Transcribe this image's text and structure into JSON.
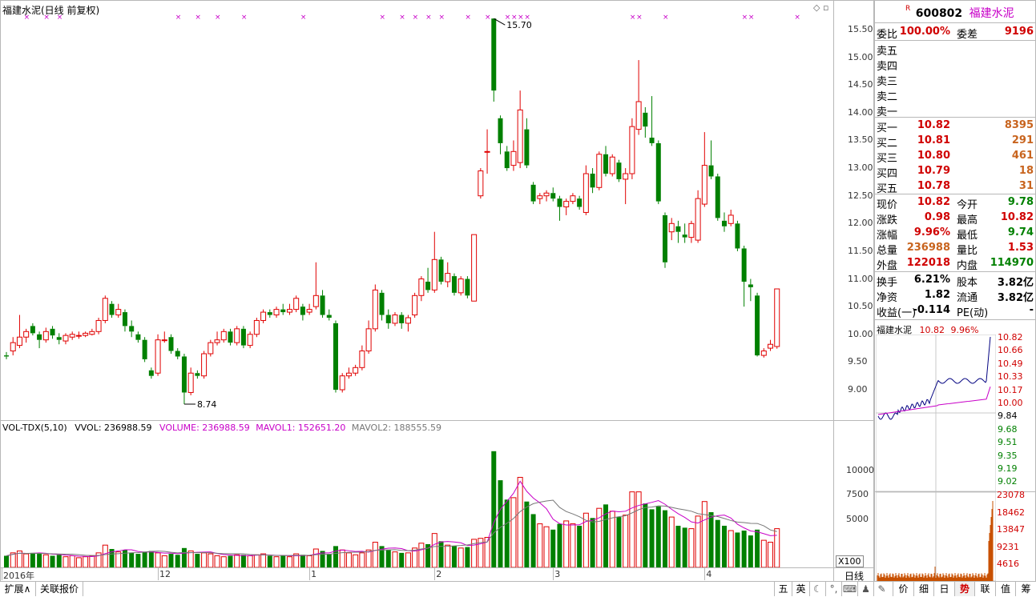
{
  "main": {
    "title": "福建水泥(日线 前复权)",
    "high_label": "15.70",
    "low_label": "8.74",
    "price_axis": [
      "15.50",
      "15.00",
      "14.50",
      "14.00",
      "13.50",
      "13.00",
      "12.50",
      "12.00",
      "11.50",
      "11.00",
      "10.50",
      "10.00",
      "9.50",
      "9.00"
    ],
    "date_axis": [
      "2016年",
      "12",
      "1",
      "2",
      "3",
      "4"
    ]
  },
  "volume": {
    "indicator": "VOL-TDX(5,10)",
    "vvol_label": "VVOL: 236988.59",
    "volume_label": "VOLUME: 236988.59",
    "mavol1_label": "MAVOL1: 152651.20",
    "mavol2_label": "MAVOL2: 188555.59",
    "axis": [
      "10000",
      "7500",
      "5000"
    ],
    "unit": "X100"
  },
  "quote": {
    "badge": "R",
    "code": "600802",
    "name": "福建水泥",
    "weibi_label": "委比",
    "weibi": "100.00%",
    "weicha_label": "委差",
    "weicha": "9196",
    "sells": [
      "卖五",
      "卖四",
      "卖三",
      "卖二",
      "卖一"
    ],
    "buys": [
      {
        "label": "买一",
        "price": "10.82",
        "vol": "8395"
      },
      {
        "label": "买二",
        "price": "10.81",
        "vol": "291"
      },
      {
        "label": "买三",
        "price": "10.80",
        "vol": "461"
      },
      {
        "label": "买四",
        "price": "10.79",
        "vol": "18"
      },
      {
        "label": "买五",
        "price": "10.78",
        "vol": "31"
      }
    ],
    "stats": [
      {
        "l1": "现价",
        "v1": "10.82",
        "l2": "今开",
        "v2": "9.78"
      },
      {
        "l1": "涨跌",
        "v1": "0.98",
        "l2": "最高",
        "v2": "10.82"
      },
      {
        "l1": "涨幅",
        "v1": "9.96%",
        "l2": "最低",
        "v2": "9.74"
      },
      {
        "l1": "总量",
        "v1": "236988",
        "l2": "量比",
        "v2": "1.53"
      },
      {
        "l1": "外盘",
        "v1": "122018",
        "l2": "内盘",
        "v2": "114970"
      }
    ],
    "stats2": [
      {
        "l1": "换手",
        "v1": "6.21%",
        "l2": "股本",
        "v2": "3.82亿"
      },
      {
        "l1": "净资",
        "v1": "1.82",
        "l2": "流通",
        "v2": "3.82亿"
      },
      {
        "l1": "收益(一)",
        "v1": "-0.114",
        "l2": "PE(动)",
        "v2": "-"
      }
    ]
  },
  "mini": {
    "name": "福建水泥",
    "price": "10.82",
    "pct": "9.96%",
    "price_axis": [
      "10.82",
      "10.66",
      "10.49",
      "10.33",
      "10.17",
      "10.00",
      "9.84",
      "9.68",
      "9.51",
      "9.35",
      "9.19",
      "9.02"
    ],
    "vol_axis": [
      "23078",
      "18462",
      "13847",
      "9231",
      "4616"
    ]
  },
  "bottom": {
    "period": "日线",
    "tab_expand": "扩展∧",
    "tab_related": "关联报价",
    "ime": [
      "五",
      "英"
    ],
    "right_tabs": [
      "价",
      "细",
      "日",
      "势",
      "联",
      "值",
      "筹"
    ]
  },
  "chart_data": {
    "type": "candlestick",
    "series": [
      {
        "o": 9.62,
        "c": 9.6,
        "h": 9.68,
        "l": 9.55,
        "v": 1200
      },
      {
        "o": 9.7,
        "c": 9.85,
        "h": 9.95,
        "l": 9.62,
        "v": 1500
      },
      {
        "o": 9.8,
        "c": 9.95,
        "h": 10.35,
        "l": 9.75,
        "v": 1700
      },
      {
        "o": 9.95,
        "c": 10.05,
        "h": 10.1,
        "l": 9.85,
        "v": 1400
      },
      {
        "o": 10.15,
        "c": 10.02,
        "h": 10.2,
        "l": 9.98,
        "v": 1500
      },
      {
        "o": 10.0,
        "c": 9.9,
        "h": 10.05,
        "l": 9.75,
        "v": 1400
      },
      {
        "o": 9.9,
        "c": 10.05,
        "h": 10.12,
        "l": 9.85,
        "v": 1300
      },
      {
        "o": 10.1,
        "c": 9.98,
        "h": 10.15,
        "l": 9.92,
        "v": 1200
      },
      {
        "o": 9.95,
        "c": 9.9,
        "h": 10.02,
        "l": 9.82,
        "v": 1300
      },
      {
        "o": 9.88,
        "c": 9.98,
        "h": 10.02,
        "l": 9.82,
        "v": 1100
      },
      {
        "o": 9.95,
        "c": 10.0,
        "h": 10.05,
        "l": 9.9,
        "v": 1200
      },
      {
        "o": 9.98,
        "c": 9.98,
        "h": 10.05,
        "l": 9.92,
        "v": 1000
      },
      {
        "o": 9.98,
        "c": 10.02,
        "h": 10.05,
        "l": 9.95,
        "v": 1100
      },
      {
        "o": 10.0,
        "c": 10.05,
        "h": 10.1,
        "l": 9.98,
        "v": 1200
      },
      {
        "o": 10.05,
        "c": 10.25,
        "h": 10.3,
        "l": 10.0,
        "v": 1500
      },
      {
        "o": 10.25,
        "c": 10.65,
        "h": 10.7,
        "l": 10.2,
        "v": 2300
      },
      {
        "o": 10.55,
        "c": 10.35,
        "h": 10.6,
        "l": 10.3,
        "v": 1900
      },
      {
        "o": 10.35,
        "c": 10.45,
        "h": 10.55,
        "l": 10.3,
        "v": 1600
      },
      {
        "o": 10.4,
        "c": 10.15,
        "h": 10.45,
        "l": 10.05,
        "v": 1800
      },
      {
        "o": 10.15,
        "c": 10.05,
        "h": 10.25,
        "l": 9.95,
        "v": 1500
      },
      {
        "o": 10.0,
        "c": 9.9,
        "h": 10.05,
        "l": 9.85,
        "v": 1400
      },
      {
        "o": 9.9,
        "c": 9.55,
        "h": 9.95,
        "l": 9.5,
        "v": 1600
      },
      {
        "o": 9.35,
        "c": 9.25,
        "h": 9.4,
        "l": 9.2,
        "v": 1700
      },
      {
        "o": 9.3,
        "c": 9.9,
        "h": 10.0,
        "l": 9.25,
        "v": 1500
      },
      {
        "o": 9.9,
        "c": 9.9,
        "h": 10.05,
        "l": 9.85,
        "v": 1200
      },
      {
        "o": 9.95,
        "c": 9.7,
        "h": 10.0,
        "l": 9.65,
        "v": 1400
      },
      {
        "o": 9.7,
        "c": 9.6,
        "h": 9.75,
        "l": 9.55,
        "v": 1300
      },
      {
        "o": 9.6,
        "c": 8.95,
        "h": 9.65,
        "l": 8.74,
        "v": 2000
      },
      {
        "o": 8.95,
        "c": 9.3,
        "h": 9.4,
        "l": 8.9,
        "v": 1700
      },
      {
        "o": 9.3,
        "c": 9.25,
        "h": 9.35,
        "l": 9.2,
        "v": 1400
      },
      {
        "o": 9.25,
        "c": 9.65,
        "h": 9.7,
        "l": 9.2,
        "v": 1500
      },
      {
        "o": 9.65,
        "c": 9.85,
        "h": 9.9,
        "l": 9.6,
        "v": 1400
      },
      {
        "o": 9.85,
        "c": 9.9,
        "h": 10.05,
        "l": 9.8,
        "v": 1200
      },
      {
        "o": 9.9,
        "c": 10.05,
        "h": 10.1,
        "l": 9.85,
        "v": 1100
      },
      {
        "o": 10.05,
        "c": 9.85,
        "h": 10.1,
        "l": 9.8,
        "v": 1200
      },
      {
        "o": 9.85,
        "c": 10.1,
        "h": 10.15,
        "l": 9.8,
        "v": 1300
      },
      {
        "o": 10.1,
        "c": 9.8,
        "h": 10.15,
        "l": 9.75,
        "v": 1300
      },
      {
        "o": 9.8,
        "c": 10.0,
        "h": 10.05,
        "l": 9.75,
        "v": 1200
      },
      {
        "o": 10.0,
        "c": 10.25,
        "h": 10.3,
        "l": 9.95,
        "v": 1300
      },
      {
        "o": 10.25,
        "c": 10.4,
        "h": 10.45,
        "l": 10.2,
        "v": 1400
      },
      {
        "o": 10.4,
        "c": 10.35,
        "h": 10.45,
        "l": 10.3,
        "v": 1200
      },
      {
        "o": 10.35,
        "c": 10.45,
        "h": 10.5,
        "l": 10.3,
        "v": 1100
      },
      {
        "o": 10.45,
        "c": 10.4,
        "h": 10.55,
        "l": 10.35,
        "v": 1200
      },
      {
        "o": 10.4,
        "c": 10.45,
        "h": 10.55,
        "l": 10.35,
        "v": 1100
      },
      {
        "o": 10.45,
        "c": 10.65,
        "h": 10.7,
        "l": 10.4,
        "v": 1400
      },
      {
        "o": 10.5,
        "c": 10.35,
        "h": 10.55,
        "l": 10.25,
        "v": 1300
      },
      {
        "o": 10.4,
        "c": 10.45,
        "h": 10.55,
        "l": 10.35,
        "v": 1200
      },
      {
        "o": 10.5,
        "c": 10.7,
        "h": 11.3,
        "l": 10.45,
        "v": 1900
      },
      {
        "o": 10.7,
        "c": 10.35,
        "h": 10.8,
        "l": 10.3,
        "v": 1700
      },
      {
        "o": 10.35,
        "c": 10.3,
        "h": 10.45,
        "l": 10.25,
        "v": 1400
      },
      {
        "o": 10.2,
        "c": 9.0,
        "h": 10.25,
        "l": 8.95,
        "v": 2200
      },
      {
        "o": 9.0,
        "c": 9.25,
        "h": 9.3,
        "l": 8.95,
        "v": 1800
      },
      {
        "o": 9.25,
        "c": 9.3,
        "h": 9.4,
        "l": 9.2,
        "v": 1500
      },
      {
        "o": 9.3,
        "c": 9.4,
        "h": 9.45,
        "l": 9.25,
        "v": 1300
      },
      {
        "o": 9.4,
        "c": 9.7,
        "h": 9.8,
        "l": 9.35,
        "v": 1500
      },
      {
        "o": 9.7,
        "c": 10.1,
        "h": 10.25,
        "l": 9.65,
        "v": 1800
      },
      {
        "o": 10.1,
        "c": 10.8,
        "h": 10.9,
        "l": 10.05,
        "v": 2600
      },
      {
        "o": 10.75,
        "c": 10.35,
        "h": 10.8,
        "l": 10.25,
        "v": 2200
      },
      {
        "o": 10.35,
        "c": 10.2,
        "h": 10.45,
        "l": 10.1,
        "v": 1800
      },
      {
        "o": 10.2,
        "c": 10.35,
        "h": 10.4,
        "l": 10.15,
        "v": 1600
      },
      {
        "o": 10.35,
        "c": 10.2,
        "h": 10.4,
        "l": 10.1,
        "v": 1500
      },
      {
        "o": 10.2,
        "c": 10.3,
        "h": 10.35,
        "l": 10.05,
        "v": 1500
      },
      {
        "o": 10.35,
        "c": 10.7,
        "h": 10.75,
        "l": 10.3,
        "v": 2000
      },
      {
        "o": 10.7,
        "c": 11.0,
        "h": 11.05,
        "l": 10.6,
        "v": 2500
      },
      {
        "o": 10.95,
        "c": 10.8,
        "h": 11.2,
        "l": 10.75,
        "v": 2400
      },
      {
        "o": 10.8,
        "c": 11.35,
        "h": 11.85,
        "l": 10.75,
        "v": 3500
      },
      {
        "o": 11.35,
        "c": 10.95,
        "h": 11.4,
        "l": 10.9,
        "v": 2700
      },
      {
        "o": 10.95,
        "c": 11.1,
        "h": 11.3,
        "l": 10.85,
        "v": 2300
      },
      {
        "o": 11.05,
        "c": 10.75,
        "h": 11.1,
        "l": 10.7,
        "v": 2200
      },
      {
        "o": 10.75,
        "c": 11.0,
        "h": 11.05,
        "l": 10.7,
        "v": 2000
      },
      {
        "o": 11.0,
        "c": 10.7,
        "h": 11.05,
        "l": 10.65,
        "v": 2100
      },
      {
        "o": 10.6,
        "c": 11.8,
        "h": 11.8,
        "l": 10.6,
        "v": 2900
      },
      {
        "o": 12.5,
        "c": 12.95,
        "h": 13.0,
        "l": 12.45,
        "v": 3000
      },
      {
        "o": 13.3,
        "c": 13.3,
        "h": 13.7,
        "l": 12.9,
        "v": 3100
      },
      {
        "o": 15.7,
        "c": 14.4,
        "h": 15.7,
        "l": 14.2,
        "v": 12000
      },
      {
        "o": 13.9,
        "c": 13.45,
        "h": 13.95,
        "l": 13.25,
        "v": 9000
      },
      {
        "o": 13.3,
        "c": 13.0,
        "h": 13.4,
        "l": 12.95,
        "v": 7000
      },
      {
        "o": 13.05,
        "c": 13.3,
        "h": 13.5,
        "l": 12.95,
        "v": 7200
      },
      {
        "o": 13.1,
        "c": 14.05,
        "h": 14.4,
        "l": 13.0,
        "v": 9300
      },
      {
        "o": 13.7,
        "c": 13.05,
        "h": 13.9,
        "l": 13.0,
        "v": 6800
      },
      {
        "o": 12.7,
        "c": 12.4,
        "h": 12.75,
        "l": 12.35,
        "v": 5500
      },
      {
        "o": 12.45,
        "c": 12.5,
        "h": 12.55,
        "l": 12.35,
        "v": 4500
      },
      {
        "o": 12.5,
        "c": 12.55,
        "h": 12.6,
        "l": 12.4,
        "v": 4200
      },
      {
        "o": 12.55,
        "c": 12.45,
        "h": 12.65,
        "l": 12.4,
        "v": 3900
      },
      {
        "o": 12.45,
        "c": 12.3,
        "h": 12.5,
        "l": 12.05,
        "v": 4500
      },
      {
        "o": 12.3,
        "c": 12.4,
        "h": 12.45,
        "l": 12.15,
        "v": 4800
      },
      {
        "o": 12.4,
        "c": 12.5,
        "h": 12.55,
        "l": 12.35,
        "v": 4500
      },
      {
        "o": 12.45,
        "c": 12.3,
        "h": 12.5,
        "l": 12.25,
        "v": 4300
      },
      {
        "o": 12.2,
        "c": 12.9,
        "h": 13.05,
        "l": 12.15,
        "v": 5600
      },
      {
        "o": 12.9,
        "c": 12.65,
        "h": 13.0,
        "l": 12.55,
        "v": 5100
      },
      {
        "o": 12.65,
        "c": 13.25,
        "h": 13.3,
        "l": 12.6,
        "v": 6100
      },
      {
        "o": 13.25,
        "c": 12.9,
        "h": 13.4,
        "l": 12.85,
        "v": 6500
      },
      {
        "o": 12.9,
        "c": 13.2,
        "h": 13.25,
        "l": 12.85,
        "v": 5800
      },
      {
        "o": 13.1,
        "c": 12.8,
        "h": 13.15,
        "l": 12.75,
        "v": 5200
      },
      {
        "o": 12.8,
        "c": 12.9,
        "h": 13.0,
        "l": 12.35,
        "v": 5400
      },
      {
        "o": 12.9,
        "c": 13.75,
        "h": 13.9,
        "l": 12.8,
        "v": 7800
      },
      {
        "o": 13.7,
        "c": 14.2,
        "h": 14.95,
        "l": 13.6,
        "v": 7800
      },
      {
        "o": 14.0,
        "c": 13.75,
        "h": 14.1,
        "l": 13.55,
        "v": 6600
      },
      {
        "o": 13.55,
        "c": 13.45,
        "h": 14.3,
        "l": 13.4,
        "v": 6000
      },
      {
        "o": 13.45,
        "c": 12.4,
        "h": 13.5,
        "l": 12.35,
        "v": 6300
      },
      {
        "o": 12.15,
        "c": 11.3,
        "h": 12.2,
        "l": 11.2,
        "v": 5900
      },
      {
        "o": 11.85,
        "c": 12.0,
        "h": 12.1,
        "l": 11.7,
        "v": 5200
      },
      {
        "o": 11.95,
        "c": 11.85,
        "h": 12.05,
        "l": 11.65,
        "v": 4300
      },
      {
        "o": 11.8,
        "c": 11.75,
        "h": 12.0,
        "l": 11.65,
        "v": 4100
      },
      {
        "o": 11.75,
        "c": 12.0,
        "h": 12.05,
        "l": 11.65,
        "v": 4000
      },
      {
        "o": 11.7,
        "c": 12.45,
        "h": 12.6,
        "l": 11.65,
        "v": 5300
      },
      {
        "o": 12.35,
        "c": 13.05,
        "h": 13.65,
        "l": 12.3,
        "v": 6800
      },
      {
        "o": 13.05,
        "c": 12.85,
        "h": 13.5,
        "l": 12.8,
        "v": 5700
      },
      {
        "o": 12.85,
        "c": 12.1,
        "h": 12.9,
        "l": 12.05,
        "v": 4900
      },
      {
        "o": 12.05,
        "c": 11.95,
        "h": 12.2,
        "l": 11.85,
        "v": 4300
      },
      {
        "o": 12.0,
        "c": 12.15,
        "h": 12.25,
        "l": 11.95,
        "v": 3800
      },
      {
        "o": 12.0,
        "c": 11.55,
        "h": 12.05,
        "l": 11.5,
        "v": 3600
      },
      {
        "o": 11.55,
        "c": 10.95,
        "h": 11.6,
        "l": 10.5,
        "v": 3800
      },
      {
        "o": 10.9,
        "c": 10.85,
        "h": 11.0,
        "l": 10.6,
        "v": 3300
      },
      {
        "o": 10.7,
        "c": 9.62,
        "h": 10.75,
        "l": 9.6,
        "v": 3900
      },
      {
        "o": 9.62,
        "c": 9.7,
        "h": 9.75,
        "l": 9.58,
        "v": 2800
      },
      {
        "o": 9.75,
        "c": 9.82,
        "h": 9.9,
        "l": 9.7,
        "v": 2600
      },
      {
        "o": 9.78,
        "c": 10.82,
        "h": 10.82,
        "l": 9.74,
        "v": 4000
      }
    ]
  }
}
